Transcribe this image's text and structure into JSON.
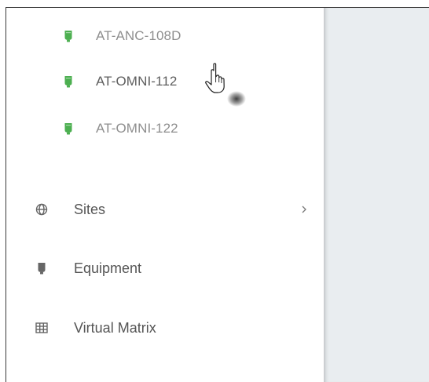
{
  "colors": {
    "device_online": "#4caf50",
    "nav_icon": "#666666",
    "main_background": "#e9edf0"
  },
  "devices": [
    {
      "label": "AT-ANC-108D",
      "icon": "amplifier-icon",
      "status": "online"
    },
    {
      "label": "AT-OMNI-112",
      "icon": "amplifier-icon",
      "status": "online"
    },
    {
      "label": "AT-OMNI-122",
      "icon": "amplifier-icon",
      "status": "online"
    }
  ],
  "nav": {
    "sites": {
      "label": "Sites",
      "icon": "globe-icon",
      "chevron": "chevron-right-icon"
    },
    "equipment": {
      "label": "Equipment",
      "icon": "equipment-icon"
    },
    "virtual_matrix": {
      "label": "Virtual Matrix",
      "icon": "grid-icon"
    }
  },
  "cursor": {
    "icon": "hand-pointer-icon"
  }
}
